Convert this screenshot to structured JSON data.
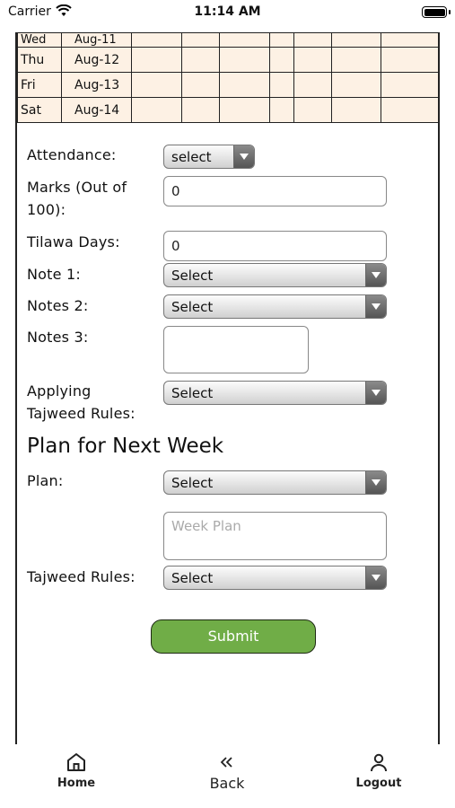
{
  "status_bar": {
    "carrier": "Carrier",
    "time": "11:14 AM"
  },
  "schedule": {
    "rows": [
      {
        "day": "Wed",
        "date": "Aug-11"
      },
      {
        "day": "Thu",
        "date": "Aug-12"
      },
      {
        "day": "Fri",
        "date": "Aug-13"
      },
      {
        "day": "Sat",
        "date": "Aug-14"
      }
    ]
  },
  "form": {
    "attendance": {
      "label": "Attendance:",
      "value": "select"
    },
    "marks": {
      "label": "Marks (Out of 100):",
      "value": "0"
    },
    "tilawa_days": {
      "label": "Tilawa Days:",
      "value": "0"
    },
    "note1": {
      "label": "Note 1:",
      "value": "Select"
    },
    "notes2": {
      "label": "Notes 2:",
      "value": "Select"
    },
    "notes3": {
      "label": "Notes 3:",
      "value": ""
    },
    "applying_tajweed": {
      "label": "Applying Tajweed Rules:",
      "value": "Select"
    },
    "plan_heading": "Plan for Next Week",
    "plan": {
      "label": "Plan:",
      "value": "Select"
    },
    "week_plan": {
      "placeholder": "Week Plan",
      "value": ""
    },
    "tajweed_rules": {
      "label": "Tajweed Rules:",
      "value": "Select"
    },
    "submit_label": "Submit"
  },
  "nav": {
    "home": "Home",
    "back": "Back",
    "logout": "Logout"
  },
  "colors": {
    "table_bg": "#fdf1e4",
    "submit_bg": "#70ad47"
  }
}
